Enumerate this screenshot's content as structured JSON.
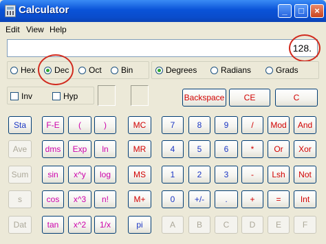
{
  "window": {
    "title": "Calculator",
    "minimize": "_",
    "maximize": "□",
    "close": "×"
  },
  "menu": {
    "edit": "Edit",
    "view": "View",
    "help": "Help"
  },
  "display": {
    "value": "128."
  },
  "base": {
    "hex": "Hex",
    "dec": "Dec",
    "oct": "Oct",
    "bin": "Bin",
    "selected": "Dec"
  },
  "angle": {
    "degrees": "Degrees",
    "radians": "Radians",
    "grads": "Grads",
    "selected": "Degrees"
  },
  "checks": {
    "inv": "Inv",
    "hyp": "Hyp"
  },
  "buttons": {
    "backspace": "Backspace",
    "ce": "CE",
    "c": "C",
    "sta": "Sta",
    "ave": "Ave",
    "sum": "Sum",
    "s": "s",
    "dat": "Dat",
    "fe": "F-E",
    "lparen": "(",
    "rparen": ")",
    "dms": "dms",
    "exp": "Exp",
    "ln": "ln",
    "sin": "sin",
    "xy": "x^y",
    "log": "log",
    "cos": "cos",
    "x3": "x^3",
    "nfact": "n!",
    "tan": "tan",
    "x2": "x^2",
    "inv": "1/x",
    "pi": "pi",
    "mc": "MC",
    "mr": "MR",
    "ms": "MS",
    "mplus": "M+",
    "d7": "7",
    "d8": "8",
    "d9": "9",
    "div": "/",
    "mod": "Mod",
    "and": "And",
    "d4": "4",
    "d5": "5",
    "d6": "6",
    "mul": "*",
    "or": "Or",
    "xor": "Xor",
    "d1": "1",
    "d2": "2",
    "d3": "3",
    "sub": "-",
    "lsh": "Lsh",
    "not": "Not",
    "d0": "0",
    "sign": "+/-",
    "dot": ".",
    "add": "+",
    "eq": "=",
    "int": "Int",
    "a": "A",
    "b": "B",
    "cc": "C",
    "d": "D",
    "e": "E",
    "f": "F"
  },
  "colors": {
    "blue": "#1b36c4",
    "red": "#d10000",
    "magenta": "#cc00aa",
    "annotation": "#d12a1e"
  }
}
